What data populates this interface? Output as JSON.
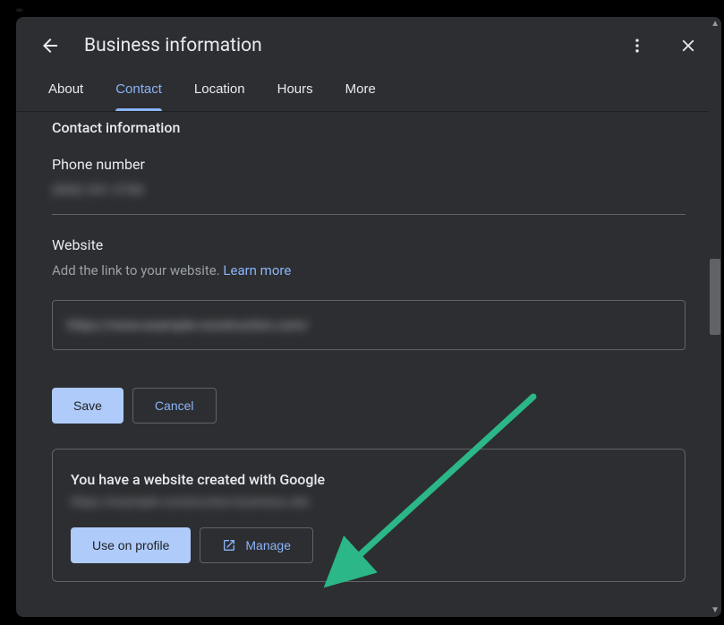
{
  "backdrop": "…",
  "header": {
    "title": "Business information"
  },
  "tabs": [
    "About",
    "Contact",
    "Location",
    "Hours",
    "More"
  ],
  "activeTabIndex": 1,
  "contact": {
    "sectionTitle": "Contact information",
    "phoneLabel": "Phone number",
    "phoneValue": "(800) 541-3780",
    "websiteLabel": "Website",
    "websiteHelper": "Add the link to your website. ",
    "learnMore": "Learn more",
    "websiteValue": "https://www.example-construction.com/",
    "saveLabel": "Save",
    "cancelLabel": "Cancel"
  },
  "googleSite": {
    "title": "You have a website created with Google",
    "url": "https://example-construction.business.site",
    "useLabel": "Use on profile",
    "manageLabel": "Manage"
  },
  "annotation": {
    "arrowColor": "#2bb787"
  }
}
